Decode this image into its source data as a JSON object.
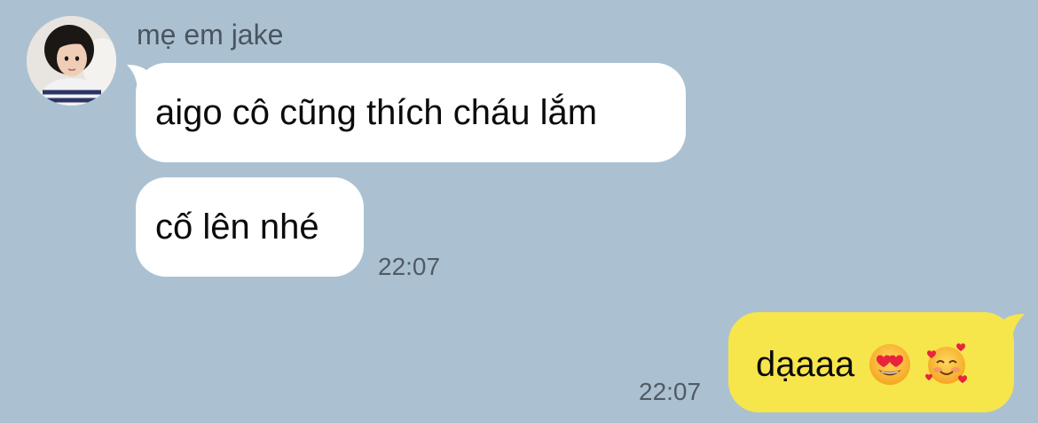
{
  "chat": {
    "sender_name": "mẹ em jake",
    "incoming": [
      {
        "text": "aigo cô cũng thích cháu lắm"
      },
      {
        "text": "cố lên nhé"
      }
    ],
    "incoming_time": "22:07",
    "outgoing": {
      "text": "dạaaa",
      "emojis": [
        "heart-eyes-emoji",
        "smiling-face-with-hearts-emoji"
      ],
      "time": "22:07"
    }
  },
  "colors": {
    "background": "#abc1d1",
    "incoming_bubble": "#ffffff",
    "outgoing_bubble": "#f7e54c",
    "timestamp": "#4f5b66"
  }
}
